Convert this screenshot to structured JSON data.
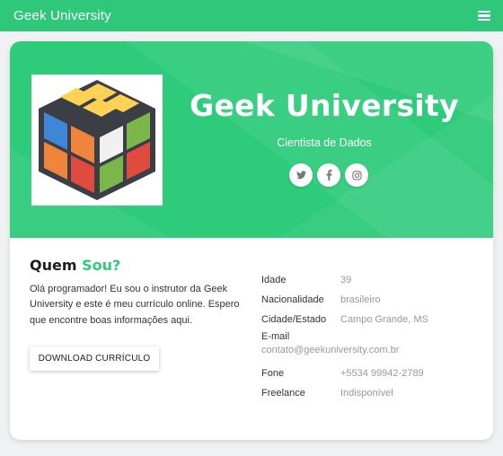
{
  "navbar": {
    "brand": "Geek University"
  },
  "hero": {
    "title": "Geek University",
    "subtitle": "Cientista de Dados",
    "bg_color": "#2ecb7b",
    "socials": [
      {
        "icon": "twitter-icon"
      },
      {
        "icon": "facebook-icon"
      },
      {
        "icon": "instagram-icon"
      }
    ]
  },
  "about": {
    "title_main": "Quem",
    "title_accent": "Sou?",
    "text": "Olá programador! Eu sou o instrutor da Geek University e este é meu currículo online. Espero que encontre boas informações aqui.",
    "download_label": "DOWNLOAD CURRÍCULO"
  },
  "info": {
    "idade_label": "Idade",
    "idade_value": "39",
    "nacionalidade_label": "Nacionalidade",
    "nacionalidade_value": "brasileiro",
    "cidade_label": "Cidade/Estado",
    "cidade_value": "Campo Grande, MS",
    "email_label": "E-mail",
    "email_value": "contato@geekuniversity.com.br",
    "fone_label": "Fone",
    "fone_value": "+5534 99942-2789",
    "freelance_label": "Freelance",
    "freelance_value": "Indisponível"
  },
  "colors": {
    "accent": "#2ecb7b",
    "navbar": "#2fc87a"
  }
}
